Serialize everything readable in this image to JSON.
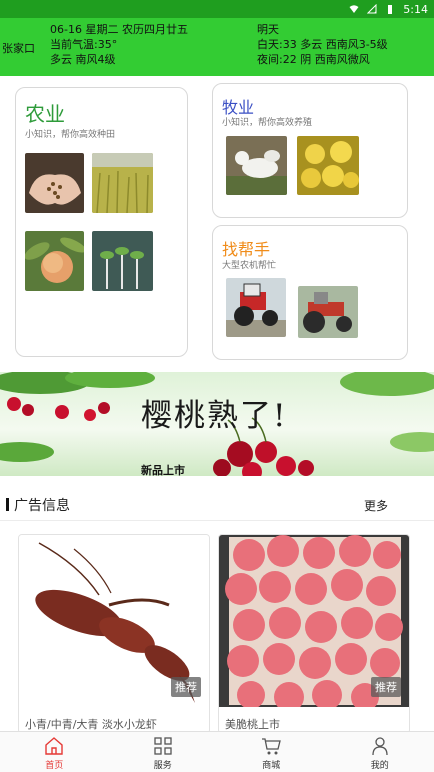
{
  "status": {
    "time": "5:14"
  },
  "weather": {
    "city": "张家口",
    "today_line1": "06-16 星期二 农历四月廿五",
    "today_line2": "当前气温:35°",
    "today_line3": "多云 南风4级",
    "tomorrow_label": "明天",
    "tomorrow_day": "白天:33 多云 西南风3-5级",
    "tomorrow_night": "夜间:22 阴 西南风微风"
  },
  "cards": {
    "agri": {
      "title": "农业",
      "sub": "小知识，帮你高效种田",
      "color": "#2e9b3a"
    },
    "livestock": {
      "title": "牧业",
      "sub": "小知识，帮你高效养殖",
      "color": "#3a4fc4"
    },
    "help": {
      "title": "找帮手",
      "sub": "大型农机帮忙",
      "color": "#f08c1a"
    }
  },
  "banner": {
    "headline": "樱桃熟了!",
    "caption": "新品上市"
  },
  "ads": {
    "title": "广告信息",
    "more": "更多",
    "items": [
      {
        "tag": "推荐",
        "caption": "小青/中青/大青 淡水小龙虾"
      },
      {
        "tag": "推荐",
        "caption": "美脆桃上市"
      }
    ]
  },
  "tabs": [
    {
      "label": "首页",
      "icon": "home-icon",
      "active": true
    },
    {
      "label": "服务",
      "icon": "grid-icon",
      "active": false
    },
    {
      "label": "商城",
      "icon": "cart-icon",
      "active": false
    },
    {
      "label": "我的",
      "icon": "person-icon",
      "active": false
    }
  ],
  "colors": {
    "accent": "#e53935",
    "weather_bg": "#33cc33"
  }
}
